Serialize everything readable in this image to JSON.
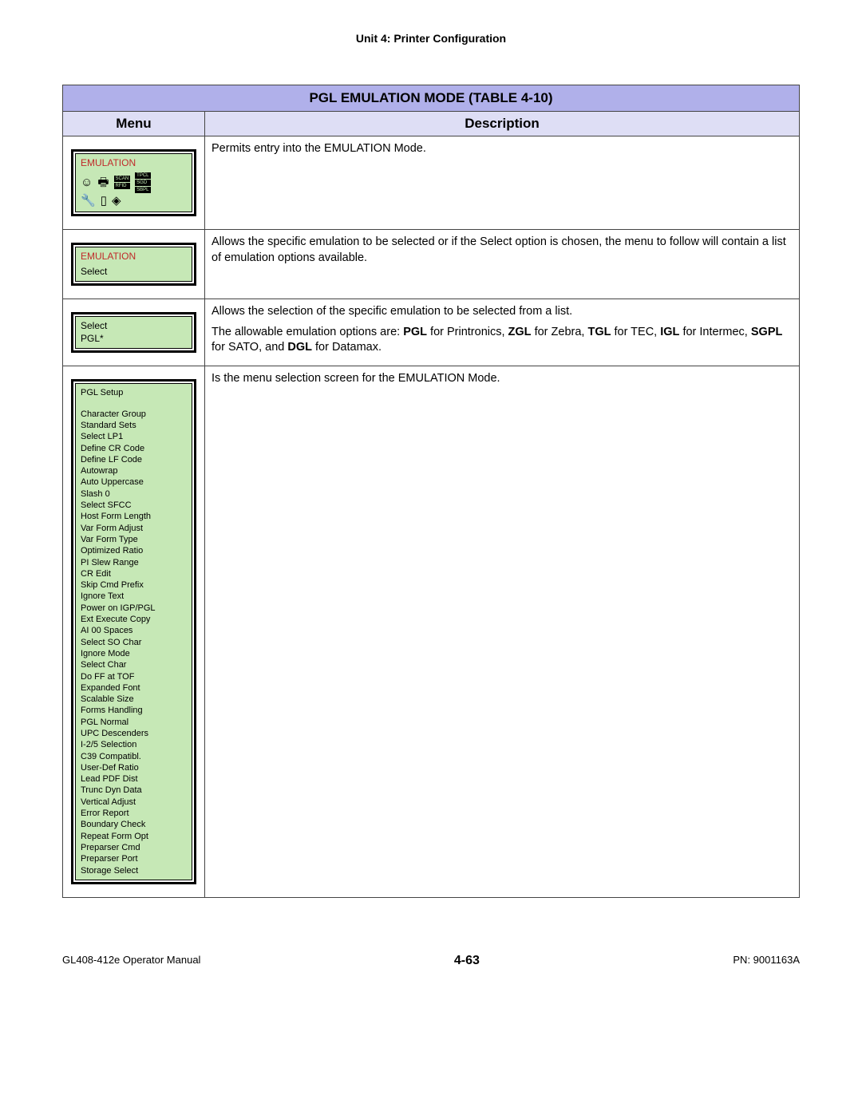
{
  "header": {
    "unit_title": "Unit 4:  Printer Configuration"
  },
  "table": {
    "title": "PGL EMULATION MODE (TABLE 4-10)",
    "col_menu": "Menu",
    "col_desc": "Description",
    "rows": [
      {
        "menu": {
          "heading": "EMULATION",
          "icons": true
        },
        "desc": [
          {
            "t": "text",
            "v": "Permits entry into the EMULATION Mode."
          }
        ]
      },
      {
        "menu": {
          "heading": "EMULATION",
          "lines": [
            "Select"
          ]
        },
        "desc": [
          {
            "t": "text",
            "v": "Allows the specific emulation to be selected or if the Select option is chosen, the menu to follow will contain a list of emulation options available."
          }
        ]
      },
      {
        "menu": {
          "lines": [
            "Select",
            "PGL*"
          ]
        },
        "desc": [
          {
            "t": "text",
            "v": "Allows the selection of the specific emulation to be selected from a list."
          },
          {
            "t": "rich",
            "parts": [
              "The allowable emulation options are: ",
              {
                "b": "PGL"
              },
              " for Printronics, ",
              {
                "b": "ZGL"
              },
              " for Zebra, ",
              {
                "b": "TGL"
              },
              " for TEC, ",
              {
                "b": "IGL"
              },
              " for Intermec, ",
              {
                "b": "SGPL"
              },
              " for SATO, and ",
              {
                "b": "DGL"
              },
              " for Datamax."
            ]
          }
        ]
      },
      {
        "menu": {
          "list_heading": "PGL Setup",
          "list": [
            "Character Group",
            "Standard Sets",
            "Select LP1",
            "Define CR Code",
            "Define LF Code",
            "Autowrap",
            "Auto Uppercase",
            "Slash 0",
            "Select SFCC",
            "Host Form Length",
            "Var Form Adjust",
            "Var Form Type",
            "Optimized Ratio",
            "PI Slew Range",
            "CR Edit",
            "Skip Cmd Prefix",
            "Ignore Text",
            "Power on IGP/PGL",
            "Ext Execute Copy",
            "AI 00 Spaces",
            "Select SO Char",
            "Ignore Mode",
            "Select Char",
            "Do FF at TOF",
            "Expanded Font",
            "Scalable Size",
            "Forms Handling",
            "PGL Normal",
            "UPC Descenders",
            "I-2/5 Selection",
            "C39 Compatibl.",
            "User-Def Ratio",
            "Lead PDF Dist",
            "Trunc Dyn Data",
            "Vertical Adjust",
            "Error Report",
            "Boundary Check",
            "Repeat Form Opt",
            "Preparser Cmd",
            "Preparser Port",
            "Storage Select"
          ]
        },
        "desc": [
          {
            "t": "text",
            "v": "Is the menu selection screen for the EMULATION Mode."
          }
        ]
      }
    ]
  },
  "footer": {
    "left": "GL408-412e Operator Manual",
    "center": "4-63",
    "right": "PN: 9001163A"
  },
  "icon_labels": {
    "scan": "SCAN",
    "rfid": "RFID",
    "tpcl": "TPCL",
    "sgd": "SGD",
    "sbpl": "SBPL"
  }
}
